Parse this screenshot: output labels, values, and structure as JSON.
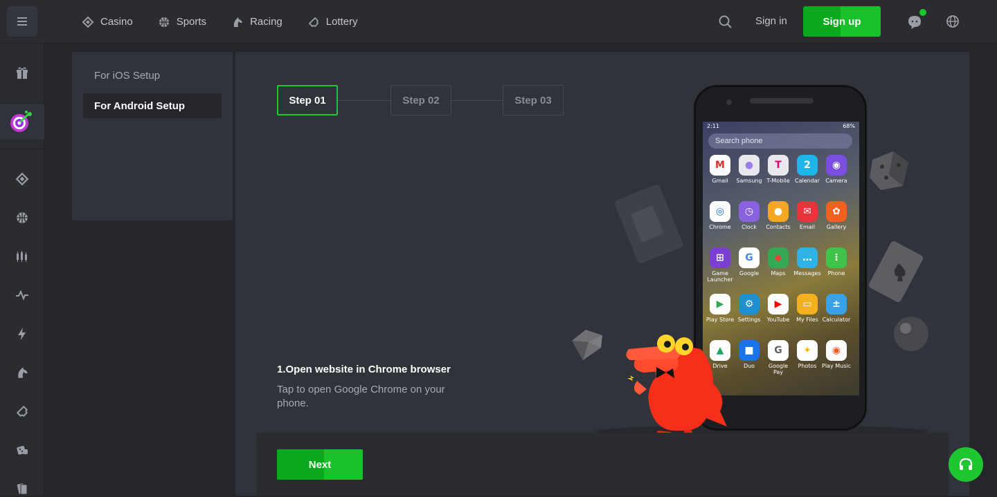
{
  "header": {
    "nav": [
      {
        "label": "Casino",
        "icon": "diamond-icon"
      },
      {
        "label": "Sports",
        "icon": "basketball-icon"
      },
      {
        "label": "Racing",
        "icon": "horse-icon"
      },
      {
        "label": "Lottery",
        "icon": "ticket-icon"
      }
    ],
    "signin_label": "Sign in",
    "signup_label": "Sign up"
  },
  "sidebar": {
    "icons": [
      "gift-icon",
      "target-promo-icon",
      "diamond-icon",
      "basketball-icon",
      "candles-icon",
      "pulse-icon",
      "lightning-icon",
      "horse-icon",
      "ticket-icon",
      "dice-icon",
      "cards-icon"
    ]
  },
  "setup_menu": {
    "ios_label": "For iOS Setup",
    "android_label": "For Android Setup"
  },
  "steps": [
    "Step 01",
    "Step 02",
    "Step 03"
  ],
  "instruction": {
    "title": "1.Open website in Chrome browser",
    "description": "Tap to open Google Chrome on your phone."
  },
  "next_label": "Next",
  "phone": {
    "time": "2:11",
    "battery": "68%",
    "search_placeholder": "Search phone",
    "apps": [
      {
        "label": "Gmail",
        "color": "#ffffff",
        "glyph": "M",
        "fg": "#d93025"
      },
      {
        "label": "Samsung",
        "color": "#e8e8ee",
        "glyph": "●",
        "fg": "#9b7de8"
      },
      {
        "label": "T-Mobile",
        "color": "#e8e8ee",
        "glyph": "T",
        "fg": "#e20074"
      },
      {
        "label": "Calendar",
        "color": "#1fb5e8",
        "glyph": "2",
        "fg": "#ffffff"
      },
      {
        "label": "Camera",
        "color": "#7a4fe0",
        "glyph": "◉",
        "fg": "#ffffff"
      },
      {
        "label": "Chrome",
        "color": "#ffffff",
        "glyph": "◎",
        "fg": "#1a73e8"
      },
      {
        "label": "Clock",
        "color": "#8a62e0",
        "glyph": "◷",
        "fg": "#ffffff"
      },
      {
        "label": "Contacts",
        "color": "#f5a623",
        "glyph": "●",
        "fg": "#ffffff"
      },
      {
        "label": "Email",
        "color": "#e8323c",
        "glyph": "✉",
        "fg": "#ffffff"
      },
      {
        "label": "Gallery",
        "color": "#f2611f",
        "glyph": "✿",
        "fg": "#ffffff"
      },
      {
        "label": "Game Launcher",
        "color": "#7b3fd4",
        "glyph": "⊞",
        "fg": "#ffffff"
      },
      {
        "label": "Google",
        "color": "#ffffff",
        "glyph": "G",
        "fg": "#4285f4"
      },
      {
        "label": "Maps",
        "color": "#34a853",
        "glyph": "◆",
        "fg": "#ea4335"
      },
      {
        "label": "Messages",
        "color": "#2fb2e6",
        "glyph": "…",
        "fg": "#ffffff"
      },
      {
        "label": "Phone",
        "color": "#3fc34a",
        "glyph": "⁞",
        "fg": "#ffffff"
      },
      {
        "label": "Play Store",
        "color": "#ffffff",
        "glyph": "▶",
        "fg": "#34a853"
      },
      {
        "label": "Settings",
        "color": "#1f8fcf",
        "glyph": "⚙",
        "fg": "#ffffff"
      },
      {
        "label": "YouTube",
        "color": "#ffffff",
        "glyph": "▶",
        "fg": "#ff0000"
      },
      {
        "label": "My Files",
        "color": "#f5b01f",
        "glyph": "▭",
        "fg": "#ffffff"
      },
      {
        "label": "Calculator",
        "color": "#3aa0e8",
        "glyph": "±",
        "fg": "#ffffff"
      },
      {
        "label": "Drive",
        "color": "#ffffff",
        "glyph": "▲",
        "fg": "#1fa463"
      },
      {
        "label": "Duo",
        "color": "#1a73e8",
        "glyph": "■",
        "fg": "#ffffff"
      },
      {
        "label": "Google Pay",
        "color": "#ffffff",
        "glyph": "G",
        "fg": "#5f6368"
      },
      {
        "label": "Photos",
        "color": "#ffffff",
        "glyph": "✦",
        "fg": "#fbbc04"
      },
      {
        "label": "Play Music",
        "color": "#ffffff",
        "glyph": "◉",
        "fg": "#ff5722"
      }
    ]
  },
  "colors": {
    "accent": "#1ec62f",
    "panel": "#30333a",
    "background": "#24262b"
  }
}
